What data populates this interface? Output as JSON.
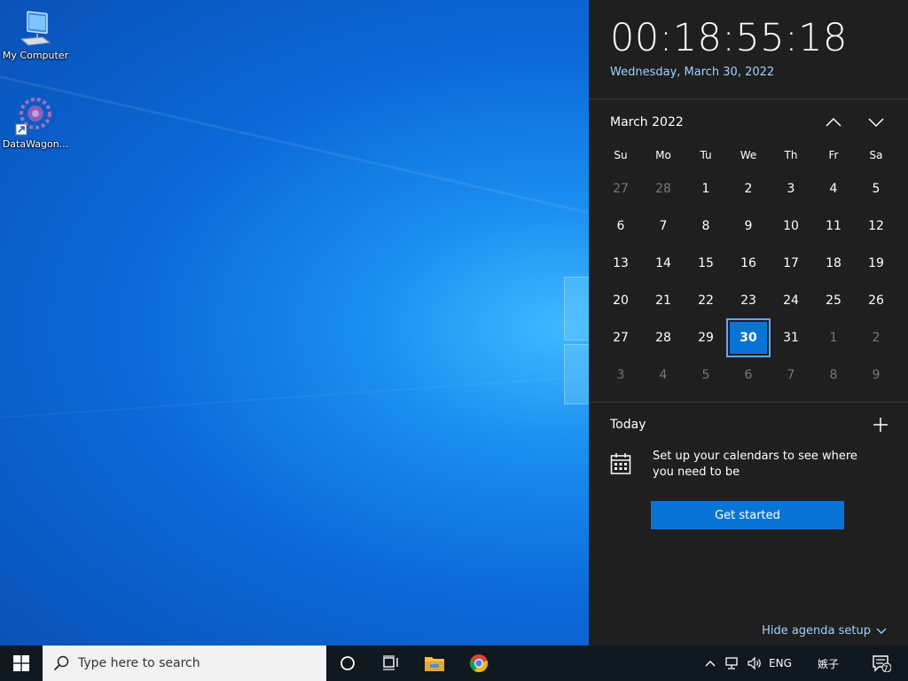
{
  "desktop": {
    "icons": [
      {
        "label": "My Computer",
        "icon": "computer-icon"
      },
      {
        "label": "DataWagon...",
        "icon": "datawagon-icon"
      }
    ]
  },
  "clock": {
    "time": "00:18:55:18",
    "date": "Wednesday, March 30, 2022"
  },
  "calendar": {
    "month_label": "March 2022",
    "weekdays": [
      "Su",
      "Mo",
      "Tu",
      "We",
      "Th",
      "Fr",
      "Sa"
    ],
    "weeks": [
      [
        "27",
        "28",
        "1",
        "2",
        "3",
        "4",
        "5"
      ],
      [
        "6",
        "7",
        "8",
        "9",
        "10",
        "11",
        "12"
      ],
      [
        "13",
        "14",
        "15",
        "16",
        "17",
        "18",
        "19"
      ],
      [
        "20",
        "21",
        "22",
        "23",
        "24",
        "25",
        "26"
      ],
      [
        "27",
        "28",
        "29",
        "30",
        "31",
        "1",
        "2"
      ],
      [
        "3",
        "4",
        "5",
        "6",
        "7",
        "8",
        "9"
      ]
    ],
    "today": "30"
  },
  "agenda": {
    "title": "Today",
    "setup_text": "Set up your calendars to see where you need to be",
    "button_label": "Get started",
    "hide_label": "Hide agenda setup"
  },
  "taskbar": {
    "search_placeholder": "Type here to search",
    "language": "ENG",
    "ime": "嫉子",
    "notification_count": "7"
  },
  "colors": {
    "accent": "#0a74d6",
    "flyout_bg": "#1f1f1f",
    "taskbar_bg": "#101820"
  }
}
